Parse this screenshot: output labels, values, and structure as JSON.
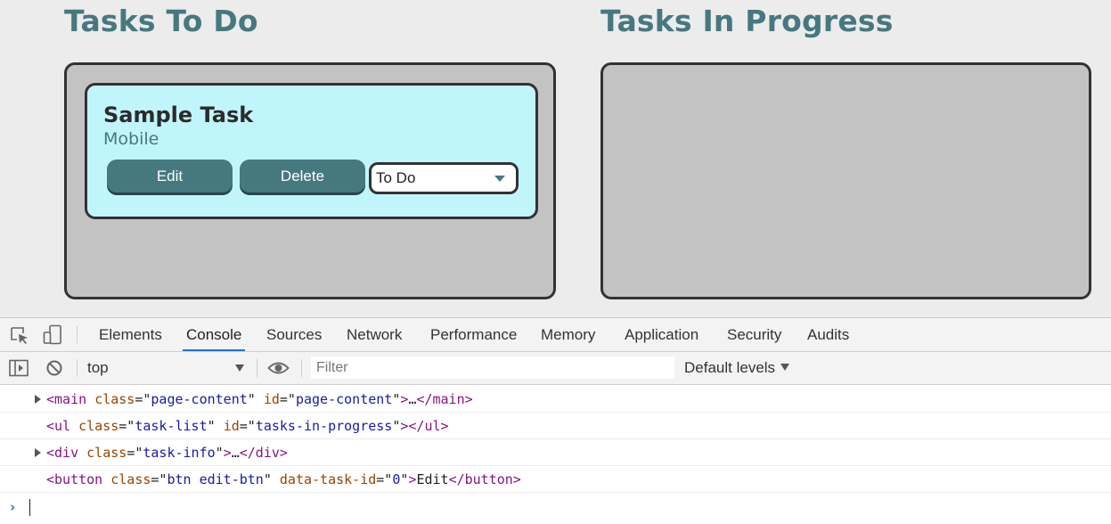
{
  "columns": {
    "todo": {
      "title": "Tasks To Do"
    },
    "in_progress": {
      "title": "Tasks In Progress"
    }
  },
  "task": {
    "name": "Sample Task",
    "type": "Mobile",
    "edit_label": "Edit",
    "delete_label": "Delete",
    "status_value": "To Do"
  },
  "devtools": {
    "tabs": [
      "Elements",
      "Console",
      "Sources",
      "Network",
      "Performance",
      "Memory",
      "Application",
      "Security",
      "Audits"
    ],
    "active_tab": "Console",
    "context": "top",
    "filter_placeholder": "Filter",
    "levels_label": "Default levels",
    "icons": [
      "inspect-element-icon",
      "device-toolbar-icon",
      "sidebar-toggle-icon",
      "clear-console-icon",
      "eye-icon"
    ],
    "accent_color": "#1a73e8",
    "console_rows": [
      {
        "expandable": true,
        "tag": "main",
        "attrs": [
          [
            "class",
            "page-content"
          ],
          [
            "id",
            "page-content"
          ]
        ],
        "inner": "…"
      },
      {
        "expandable": false,
        "tag": "ul",
        "attrs": [
          [
            "class",
            "task-list"
          ],
          [
            "id",
            "tasks-in-progress"
          ]
        ],
        "inner": ""
      },
      {
        "expandable": true,
        "tag": "div",
        "attrs": [
          [
            "class",
            "task-info"
          ]
        ],
        "inner": "…"
      },
      {
        "expandable": false,
        "tag": "button",
        "attrs": [
          [
            "class",
            "btn edit-btn"
          ],
          [
            "data-task-id",
            "0"
          ]
        ],
        "inner": "Edit"
      }
    ],
    "prompt_symbol": "›"
  },
  "colors": {
    "title": "#467880",
    "card_bg": "#c1f5fc",
    "button_bg": "#467880",
    "list_bg": "#c3c3c3"
  }
}
